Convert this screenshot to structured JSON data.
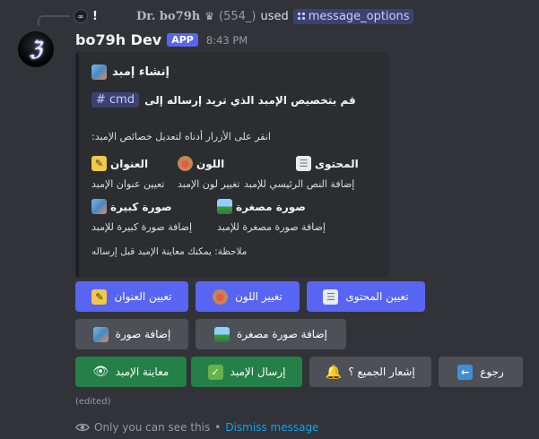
{
  "reply": {
    "avatar_initial": "∞",
    "prefix": "!",
    "username": "Dr. bo79h",
    "crown": "♛",
    "count": "(554_)",
    "used": "used",
    "command": "message_options"
  },
  "message": {
    "avatar_text": "ℨ",
    "username": "bo79h Dev",
    "app_tag": "APP",
    "timestamp": "8:43 PM",
    "edited": "(edited)"
  },
  "embed": {
    "title": "إنشاء إمبد",
    "description": "قم بتخصيص الإمبد الذي تريد إرساله إلى",
    "channel": "# cmd",
    "hint": "انقر على الأزرار أدناه لتعديل خصائص الإمبد:",
    "fields": [
      {
        "name": "العنوان",
        "value": "تعيين عنوان الإمبد"
      },
      {
        "name": "اللون",
        "value": "تغيير لون الإمبد"
      },
      {
        "name": "المحتوى",
        "value": "إضافة النص الرئيسي للإمبد"
      },
      {
        "name": "صورة كبيرة",
        "value": "إضافة صورة كبيرة للإمبد"
      },
      {
        "name": "صورة مصغرة",
        "value": "إضافة صورة مصغرة للإمبد"
      }
    ],
    "note": "ملاحظة: يمكنك معاينة الإمبد قبل إرساله"
  },
  "buttons": {
    "row1": [
      {
        "label": "تعيين العنوان",
        "icon": "pencil-icon"
      },
      {
        "label": "تغيير اللون",
        "icon": "palette-icon"
      },
      {
        "label": "تعيين المحتوى",
        "icon": "document-icon"
      }
    ],
    "row2": [
      {
        "label": "إضافة صورة",
        "icon": "image-icon"
      },
      {
        "label": "إضافة صورة مصغرة",
        "icon": "landscape-icon"
      }
    ],
    "row3": [
      {
        "label": "معاينة الإمبد",
        "icon": "eye-icon"
      },
      {
        "label": "إرسال الإمبد",
        "icon": "check-icon"
      },
      {
        "label": "إشعار الجميع ؟",
        "icon": "bell-icon"
      },
      {
        "label": "رجوع",
        "icon": "back-arrow-icon"
      }
    ]
  },
  "footer": {
    "visibility": "Only you can see this",
    "separator": "•",
    "dismiss": "Dismiss message"
  },
  "colors": {
    "background": "#313338",
    "embed_bg": "#2b2d31",
    "blurple": "#5865f2",
    "secondary": "#4e5058",
    "success": "#248046",
    "link": "#00a8fc"
  }
}
